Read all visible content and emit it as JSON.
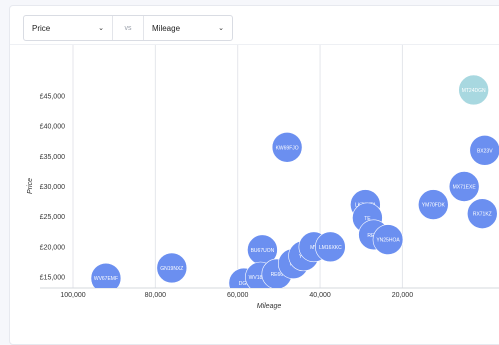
{
  "controls": {
    "x_select": "Price",
    "vs_label": "vs",
    "y_select": "Mileage"
  },
  "colors": {
    "bubble": "#6b8ff0",
    "bubble_highlight": "#a8d8e0",
    "grid": "#e4e6eb"
  },
  "chart_data": {
    "type": "scatter",
    "title": "",
    "xlabel": "Mileage",
    "ylabel": "Price",
    "x_reversed": true,
    "xlim": [
      100000,
      0
    ],
    "ylim": [
      13500,
      49000
    ],
    "x_ticks": [
      100000,
      80000,
      60000,
      40000,
      20000
    ],
    "x_tick_labels": [
      "100,000",
      "80,000",
      "60,000",
      "40,000",
      "20,000"
    ],
    "y_ticks": [
      15000,
      20000,
      25000,
      30000,
      35000,
      40000,
      45000
    ],
    "y_tick_labels": [
      "£15,000",
      "£20,000",
      "£25,000",
      "£30,000",
      "£35,000",
      "£40,000",
      "£45,000"
    ],
    "grid": true,
    "points": [
      {
        "label": "WV67EMF",
        "x": 92000,
        "y": 14800
      },
      {
        "label": "GN19NXZ",
        "x": 76000,
        "y": 16500
      },
      {
        "label": "KW69FJO",
        "x": 48000,
        "y": 36500
      },
      {
        "label": "BU67UON",
        "x": 54000,
        "y": 19500
      },
      {
        "label": "DG6",
        "x": 58500,
        "y": 14000
      },
      {
        "label": "WV18XTY",
        "x": 54500,
        "y": 15000
      },
      {
        "label": "RE66",
        "x": 50500,
        "y": 15500
      },
      {
        "label": "RE",
        "x": 46500,
        "y": 17200
      },
      {
        "label": "YY6",
        "x": 44000,
        "y": 18500
      },
      {
        "label": "MV",
        "x": 41500,
        "y": 20000
      },
      {
        "label": "LM16XKC",
        "x": 37500,
        "y": 20000
      },
      {
        "label": "LK71VTA",
        "x": 29000,
        "y": 27000
      },
      {
        "label": "TE",
        "x": 28500,
        "y": 24800
      },
      {
        "label": "RE22",
        "x": 27000,
        "y": 22000
      },
      {
        "label": "YN25HOA",
        "x": 23500,
        "y": 21200
      },
      {
        "label": "YM70FDK",
        "x": 12500,
        "y": 27000
      },
      {
        "label": "MX71EXE",
        "x": 5000,
        "y": 30000
      },
      {
        "label": "RX71KZ",
        "x": 600,
        "y": 25500
      },
      {
        "label": "BX23V",
        "x": 0,
        "y": 36000
      },
      {
        "label": "MT24DGN",
        "x": 2700,
        "y": 46000,
        "highlight": true
      }
    ]
  }
}
